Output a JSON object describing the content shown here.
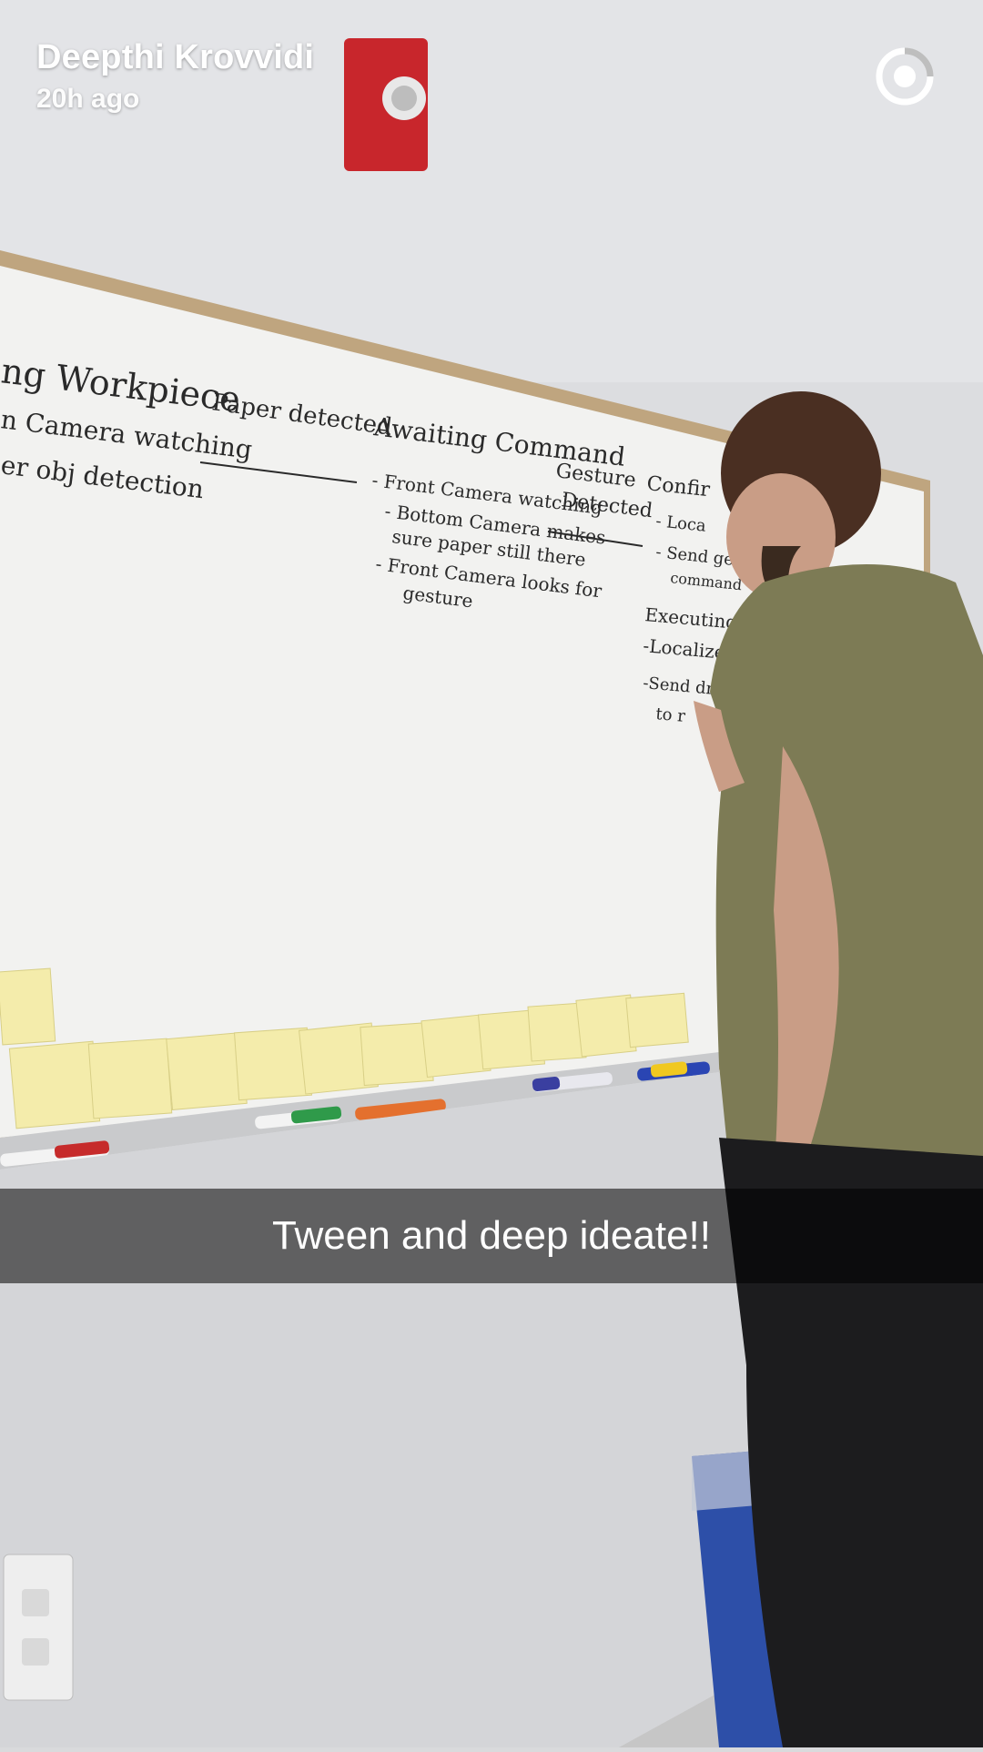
{
  "story": {
    "sender_name": "Deepthi Krovvidi",
    "timestamp": "20h ago",
    "timer_icon": "timer-ring-icon",
    "caption": "Tween and deep ideate!!"
  },
  "whiteboard": {
    "heading_left": "ng Workpiece",
    "left_lines": [
      "n Camera watching",
      "er obj detection"
    ],
    "paper_detected": "Paper detected",
    "awaiting_title": "Awaiting Command",
    "awaiting_lines": [
      "- Front Camera watching",
      "- Bottom Camera makes",
      "sure paper still there",
      "- Front Camera looks for",
      "gesture"
    ],
    "gesture_label": [
      "Gesture",
      "Detected"
    ],
    "confirm_title": "Confir",
    "confirm_lines": [
      "- Loca",
      "- Send gest",
      "command"
    ],
    "executing_title": "Executing Comm",
    "executing_lines": [
      "-Localize Robot",
      "-Send drive comm",
      "to r"
    ]
  }
}
